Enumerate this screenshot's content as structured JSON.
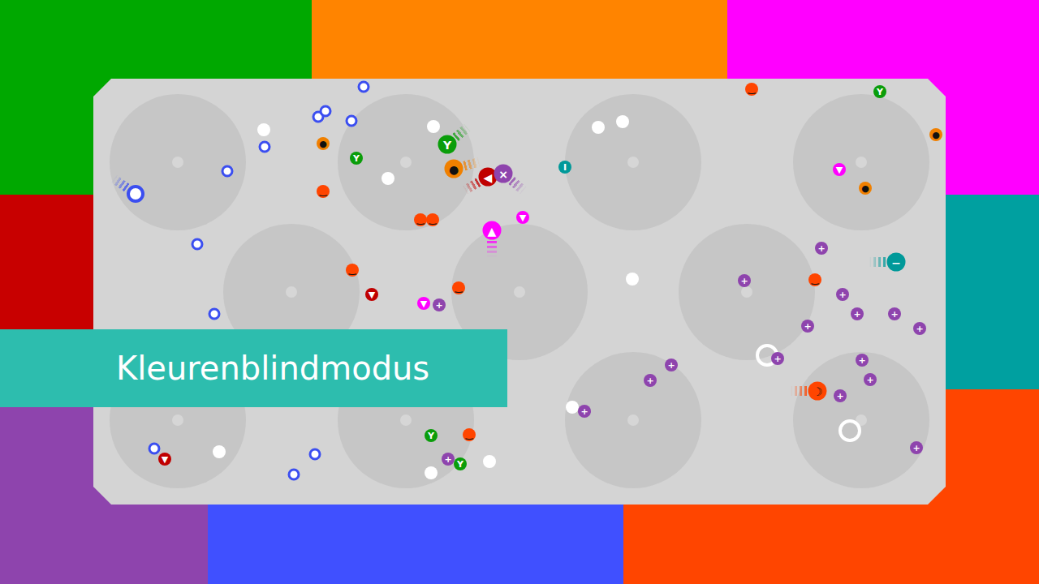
{
  "title": "Kleurenblindmodus",
  "frame": [
    {
      "color": "#00a800"
    },
    {
      "color": "#ff8400"
    },
    {
      "color": "#ff00ff"
    },
    {
      "color": "#c80000"
    },
    {
      "color": "#00a0a0"
    },
    {
      "color": "#8e44ad"
    },
    {
      "color": "#4050ff"
    },
    {
      "color": "#ff4500"
    }
  ],
  "pieces": [
    {
      "kind": "ring",
      "color": "#3b4ef0",
      "symbol": "",
      "moving": true
    },
    {
      "kind": "ring",
      "color": "#3b4ef0",
      "symbol": "",
      "moving": false
    },
    {
      "kind": "ring",
      "color": "#3b4ef0",
      "symbol": "",
      "moving": false
    },
    {
      "kind": "ring",
      "color": "#3b4ef0",
      "symbol": "",
      "moving": false
    },
    {
      "kind": "ring",
      "color": "#3b4ef0",
      "symbol": "",
      "moving": false
    },
    {
      "kind": "ring",
      "color": "#3b4ef0",
      "symbol": "",
      "moving": false
    },
    {
      "kind": "ring",
      "color": "#3b4ef0",
      "symbol": "",
      "moving": false
    },
    {
      "kind": "ring",
      "color": "#3b4ef0",
      "symbol": "",
      "moving": false
    },
    {
      "kind": "ring",
      "color": "#3b4ef0",
      "symbol": "",
      "moving": false
    },
    {
      "kind": "ring",
      "color": "#3b4ef0",
      "symbol": "",
      "moving": false
    },
    {
      "kind": "ring",
      "color": "#3b4ef0",
      "symbol": "",
      "moving": false
    },
    {
      "kind": "ring",
      "color": "#3b4ef0",
      "symbol": "",
      "moving": false
    },
    {
      "kind": "dot",
      "color": "#ffffff",
      "symbol": "",
      "moving": false
    },
    {
      "kind": "dot",
      "color": "#ffffff",
      "symbol": "",
      "moving": false
    },
    {
      "kind": "dot",
      "color": "#ffffff",
      "symbol": "",
      "moving": false
    },
    {
      "kind": "dot",
      "color": "#ffffff",
      "symbol": "",
      "moving": false
    },
    {
      "kind": "dot",
      "color": "#ffffff",
      "symbol": "",
      "moving": false
    },
    {
      "kind": "dot",
      "color": "#ffffff",
      "symbol": "",
      "moving": false
    },
    {
      "kind": "dot",
      "color": "#ffffff",
      "symbol": "",
      "moving": false
    },
    {
      "kind": "dot",
      "color": "#ffffff",
      "symbol": "",
      "moving": false
    },
    {
      "kind": "dot",
      "color": "#ffffff",
      "symbol": "",
      "moving": false
    },
    {
      "kind": "dot",
      "color": "#ffffff",
      "symbol": "",
      "moving": false
    },
    {
      "kind": "big-ring",
      "color": "#ffffff",
      "symbol": "",
      "moving": false
    },
    {
      "kind": "big-ring",
      "color": "#ffffff",
      "symbol": "",
      "moving": false
    },
    {
      "kind": "token",
      "color": "#f08000",
      "symbol": "●",
      "moving": false
    },
    {
      "kind": "token",
      "color": "#f08000",
      "symbol": "●",
      "moving": true
    },
    {
      "kind": "token",
      "color": "#f08000",
      "symbol": "●",
      "moving": false
    },
    {
      "kind": "token",
      "color": "#f08000",
      "symbol": "●",
      "moving": false
    },
    {
      "kind": "token",
      "color": "#ff4500",
      "symbol": "‿",
      "moving": false
    },
    {
      "kind": "token",
      "color": "#ff4500",
      "symbol": "‿",
      "moving": false
    },
    {
      "kind": "token",
      "color": "#ff4500",
      "symbol": "‿",
      "moving": false
    },
    {
      "kind": "token",
      "color": "#ff4500",
      "symbol": "‿",
      "moving": false
    },
    {
      "kind": "token",
      "color": "#ff4500",
      "symbol": "‿",
      "moving": false
    },
    {
      "kind": "token",
      "color": "#ff4500",
      "symbol": "‿",
      "moving": false
    },
    {
      "kind": "token",
      "color": "#ff4500",
      "symbol": "‿",
      "moving": false
    },
    {
      "kind": "token",
      "color": "#ff4500",
      "symbol": "‿",
      "moving": false
    },
    {
      "kind": "token",
      "color": "#ff4500",
      "symbol": "☽",
      "moving": true
    },
    {
      "kind": "token",
      "color": "#0a9d0a",
      "symbol": "Y",
      "moving": false
    },
    {
      "kind": "token",
      "color": "#0a9d0a",
      "symbol": "Y",
      "moving": false
    },
    {
      "kind": "token",
      "color": "#0a9d0a",
      "symbol": "Y",
      "moving": false
    },
    {
      "kind": "token",
      "color": "#0a9d0a",
      "symbol": "Y",
      "moving": false
    },
    {
      "kind": "token",
      "color": "#0a9d0a",
      "symbol": "Y",
      "moving": true
    },
    {
      "kind": "token",
      "color": "#c00000",
      "symbol": "▼",
      "moving": false
    },
    {
      "kind": "token",
      "color": "#c00000",
      "symbol": "▼",
      "moving": false
    },
    {
      "kind": "token",
      "color": "#c00000",
      "symbol": "◀",
      "moving": true
    },
    {
      "kind": "token",
      "color": "#8e44ad",
      "symbol": "+",
      "moving": false
    },
    {
      "kind": "token",
      "color": "#8e44ad",
      "symbol": "+",
      "moving": false
    },
    {
      "kind": "token",
      "color": "#8e44ad",
      "symbol": "+",
      "moving": false
    },
    {
      "kind": "token",
      "color": "#8e44ad",
      "symbol": "+",
      "moving": false
    },
    {
      "kind": "token",
      "color": "#8e44ad",
      "symbol": "+",
      "moving": false
    },
    {
      "kind": "token",
      "color": "#8e44ad",
      "symbol": "+",
      "moving": false
    },
    {
      "kind": "token",
      "color": "#8e44ad",
      "symbol": "+",
      "moving": false
    },
    {
      "kind": "token",
      "color": "#8e44ad",
      "symbol": "+",
      "moving": false
    },
    {
      "kind": "token",
      "color": "#8e44ad",
      "symbol": "+",
      "moving": false
    },
    {
      "kind": "token",
      "color": "#8e44ad",
      "symbol": "+",
      "moving": false
    },
    {
      "kind": "token",
      "color": "#8e44ad",
      "symbol": "+",
      "moving": false
    },
    {
      "kind": "token",
      "color": "#8e44ad",
      "symbol": "+",
      "moving": false
    },
    {
      "kind": "token",
      "color": "#8e44ad",
      "symbol": "+",
      "moving": false
    },
    {
      "kind": "token",
      "color": "#8e44ad",
      "symbol": "+",
      "moving": false
    },
    {
      "kind": "token",
      "color": "#8e44ad",
      "symbol": "+",
      "moving": false
    },
    {
      "kind": "token",
      "color": "#8e44ad",
      "symbol": "+",
      "moving": false
    },
    {
      "kind": "token",
      "color": "#8e44ad",
      "symbol": "+",
      "moving": false
    },
    {
      "kind": "token",
      "color": "#8e44ad",
      "symbol": "×",
      "moving": true
    },
    {
      "kind": "token",
      "color": "#ff00ff",
      "symbol": "▼",
      "moving": false
    },
    {
      "kind": "token",
      "color": "#ff00ff",
      "symbol": "▼",
      "moving": false
    },
    {
      "kind": "token",
      "color": "#ff00ff",
      "symbol": "▼",
      "moving": false
    },
    {
      "kind": "token",
      "color": "#ff00ff",
      "symbol": "▲",
      "moving": true
    },
    {
      "kind": "token",
      "color": "#009999",
      "symbol": "I",
      "moving": false
    },
    {
      "kind": "token",
      "color": "#009999",
      "symbol": "−",
      "moving": true
    }
  ]
}
